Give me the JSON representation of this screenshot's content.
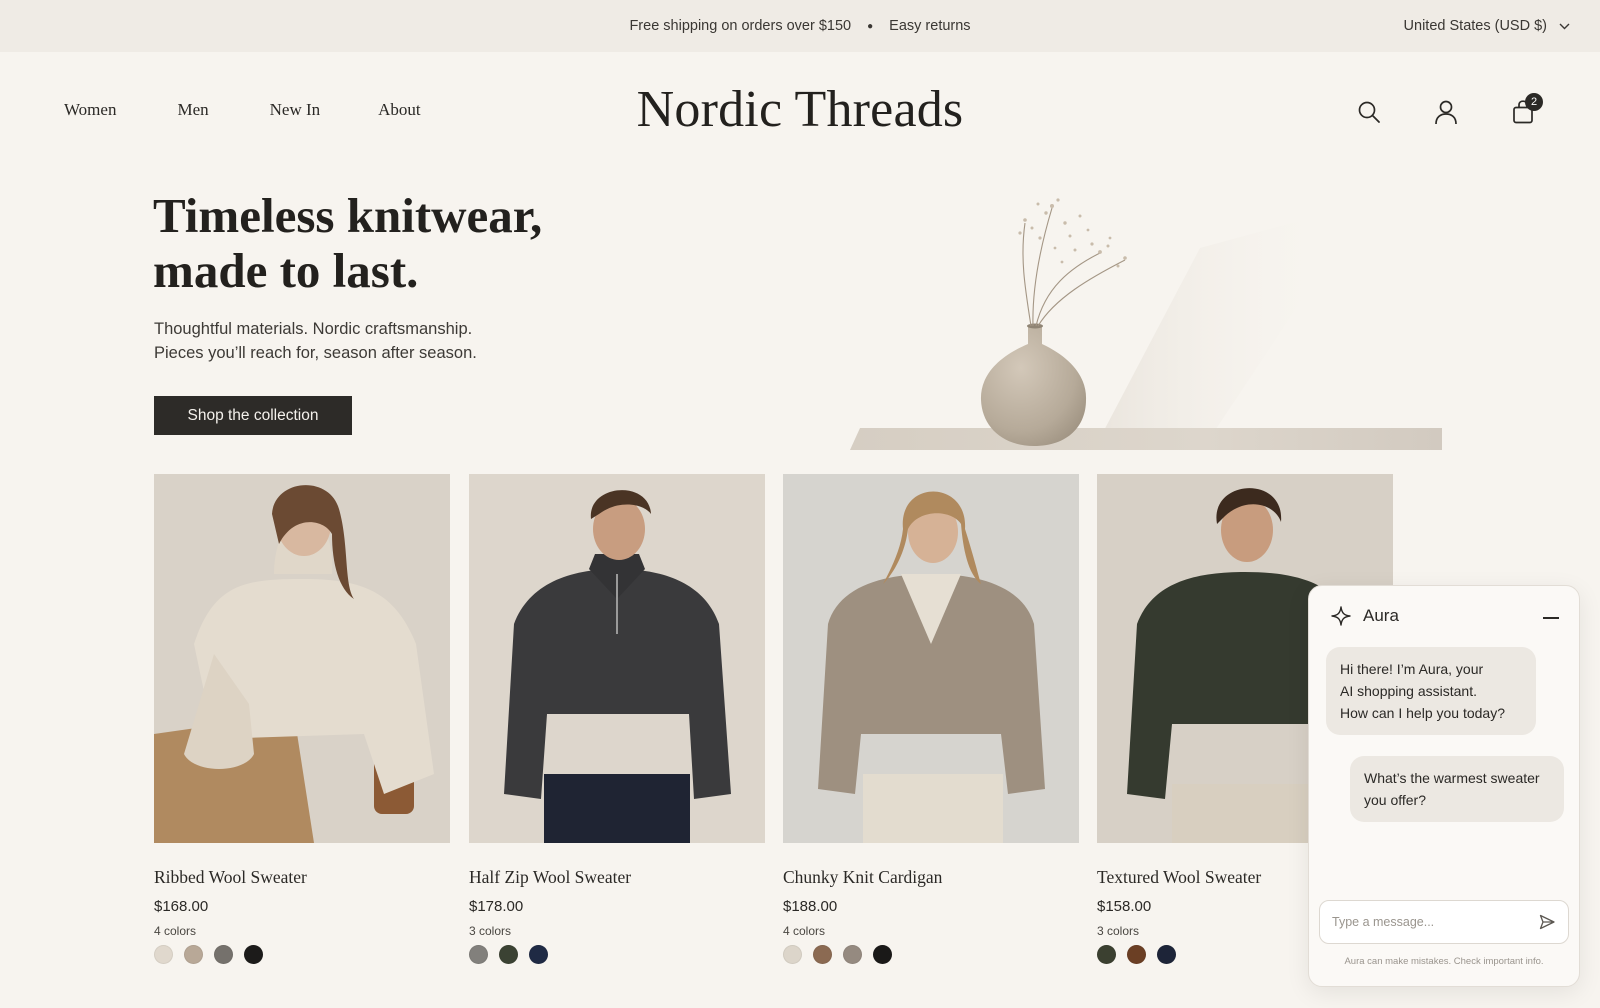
{
  "announcement": {
    "shipping": "Free shipping on orders over $150",
    "returns": "Easy returns",
    "region": "United States (USD $)"
  },
  "nav": {
    "women": "Women",
    "men": "Men",
    "new_in": "New In",
    "about": "About"
  },
  "brand": "Nordic Threads",
  "header_icons": {
    "search": "search-icon",
    "account": "account-icon",
    "cart": "cart-icon",
    "cart_count": "2"
  },
  "hero": {
    "title_line1": "Timeless knitwear,",
    "title_line2": "made to last.",
    "sub_line1": "Thoughtful materials. Nordic craftsmanship.",
    "sub_line2": "Pieces you’ll reach for, season after season.",
    "cta": "Shop the collection"
  },
  "products": [
    {
      "name": "Ribbed Wool Sweater",
      "price": "$168.00",
      "colors_label": "4 colors",
      "swatches": [
        "#e0d8cd",
        "#b8a897",
        "#75716c",
        "#1c1b1a"
      ]
    },
    {
      "name": "Half Zip Wool Sweater",
      "price": "$178.00",
      "colors_label": "3 colors",
      "swatches": [
        "#82807c",
        "#3b4233",
        "#1f2a44"
      ]
    },
    {
      "name": "Chunky Knit Cardigan",
      "price": "$188.00",
      "colors_label": "4 colors",
      "swatches": [
        "#dcd5ca",
        "#8b6a52",
        "#958a80",
        "#1a1918"
      ]
    },
    {
      "name": "Textured Wool Sweater",
      "price": "$158.00",
      "colors_label": "3 colors",
      "swatches": [
        "#3b4030",
        "#6b3f24",
        "#1d2438"
      ]
    }
  ],
  "chat": {
    "title": "Aura",
    "bot_line1": "Hi there! I’m Aura, your",
    "bot_line2": "AI shopping assistant.",
    "bot_line3": "How can I help you today?",
    "user_line1": "What’s the warmest sweater",
    "user_line2": "you offer?",
    "input_placeholder": "Type a message...",
    "disclaimer": "Aura can make mistakes. Check important info."
  },
  "colors": {
    "background": "#f7f4ef",
    "announcement_bg": "#efebe5",
    "button": "#2d2b28",
    "text": "#2b2926"
  }
}
